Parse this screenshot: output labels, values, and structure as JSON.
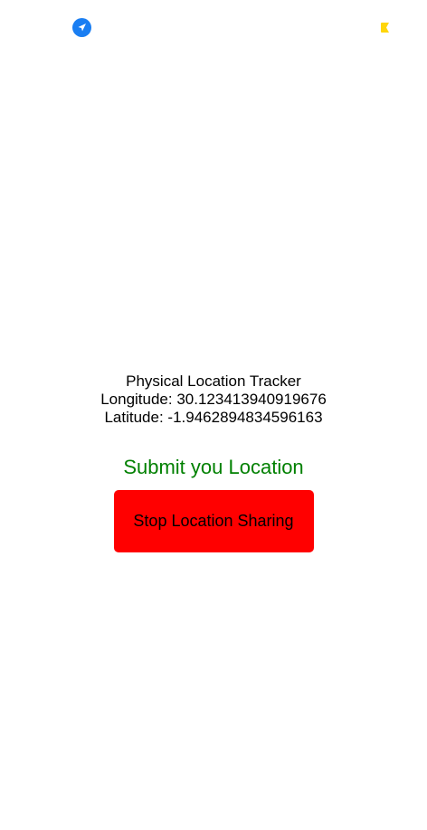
{
  "status_bar": {
    "location_icon": "location-arrow-icon",
    "battery_icon": "battery-icon",
    "colors": {
      "location": "#1a7ef2",
      "battery": "#ffd60a"
    }
  },
  "tracker": {
    "title": "Physical Location Tracker",
    "longitude_text": "Longitude: 30.123413940919676",
    "latitude_text": "Latitude: -1.9462894834596163"
  },
  "actions": {
    "submit_label": "Submit you Location",
    "stop_label": "Stop Location Sharing"
  },
  "colors": {
    "submit_text": "#008000",
    "stop_button_bg": "#ff0000"
  }
}
